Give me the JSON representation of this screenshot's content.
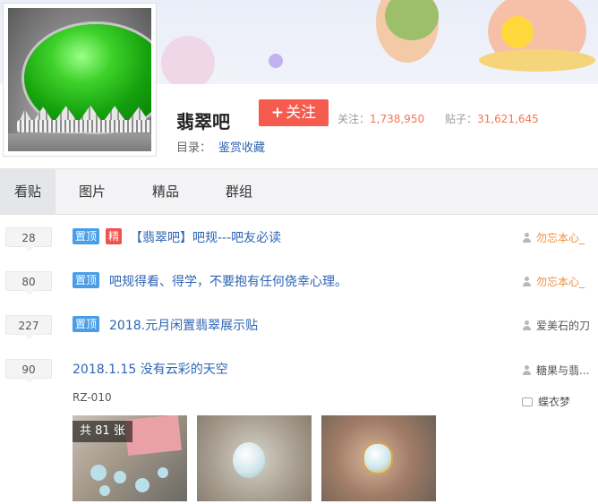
{
  "forum": {
    "name": "翡翠吧",
    "follow_label": "关注",
    "follow_plus": "+",
    "stats": {
      "followers_label": "关注：",
      "followers_value": "1,738,950",
      "posts_label": "贴子：",
      "posts_value": "31,621,645"
    },
    "catalog_label": "目录：",
    "catalog_value": "鉴赏收藏"
  },
  "tabs": [
    {
      "label": "看贴",
      "active": true
    },
    {
      "label": "图片",
      "active": false
    },
    {
      "label": "精品",
      "active": false
    },
    {
      "label": "群组",
      "active": false
    }
  ],
  "threads": [
    {
      "replies": "28",
      "badges": [
        "置顶",
        "精"
      ],
      "title": "【翡翠吧】吧规---吧友必读",
      "author": "勿忘本心_",
      "author_color": "#f08f3a"
    },
    {
      "replies": "80",
      "badges": [
        "置顶"
      ],
      "title": "吧规得看、得学，不要抱有任何侥幸心理。",
      "author": "勿忘本心_",
      "author_color": "#f08f3a"
    },
    {
      "replies": "227",
      "badges": [
        "置顶"
      ],
      "title": "2018.元月闲置翡翠展示贴",
      "author": "爱美石的刀",
      "author_color": "#555555"
    },
    {
      "replies": "90",
      "badges": [],
      "title": "2018.1.15 没有云彩的天空",
      "author": "糖果与翡...",
      "author_color": "#555555",
      "excerpt": "RZ-010",
      "last_reply": "蝶衣梦",
      "image_count": "共 81 张"
    }
  ],
  "colors": {
    "link": "#2d64b3",
    "follow_button": "#f55b4e",
    "stat_number": "#f4764f",
    "badge_top": "#4a9ee8",
    "badge_good": "#f0524f"
  },
  "icons": [
    "user-icon",
    "reply-icon"
  ]
}
